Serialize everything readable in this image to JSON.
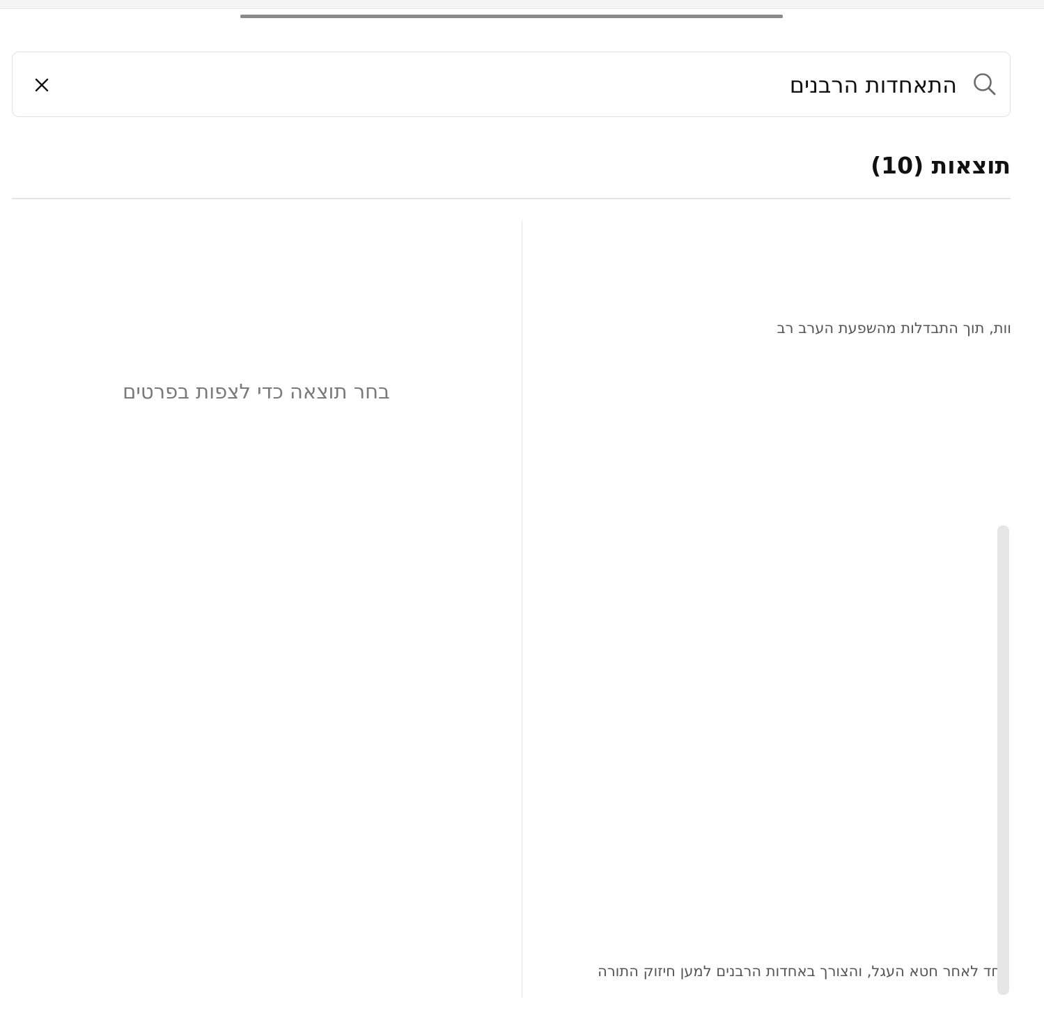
{
  "search": {
    "query": "התאחדות הרבנים",
    "icon": "search-icon",
    "clear_icon": "close-icon"
  },
  "results": {
    "title": "תוצאות (10)",
    "items": [
      {
        "snippet": "וות, תוך התבדלות מהשפעת הערב רב"
      },
      {
        "snippet": "חד לאחר חטא העגל, והצורך באחדות הרבנים למען חיזוק התורה"
      }
    ]
  },
  "details": {
    "placeholder": "בחר תוצאה כדי לצפות בפרטים"
  },
  "colors": {
    "text_primary": "#111111",
    "text_muted": "#7a7a7a",
    "border": "#e2e2e2",
    "handle": "#8a8a8a"
  }
}
